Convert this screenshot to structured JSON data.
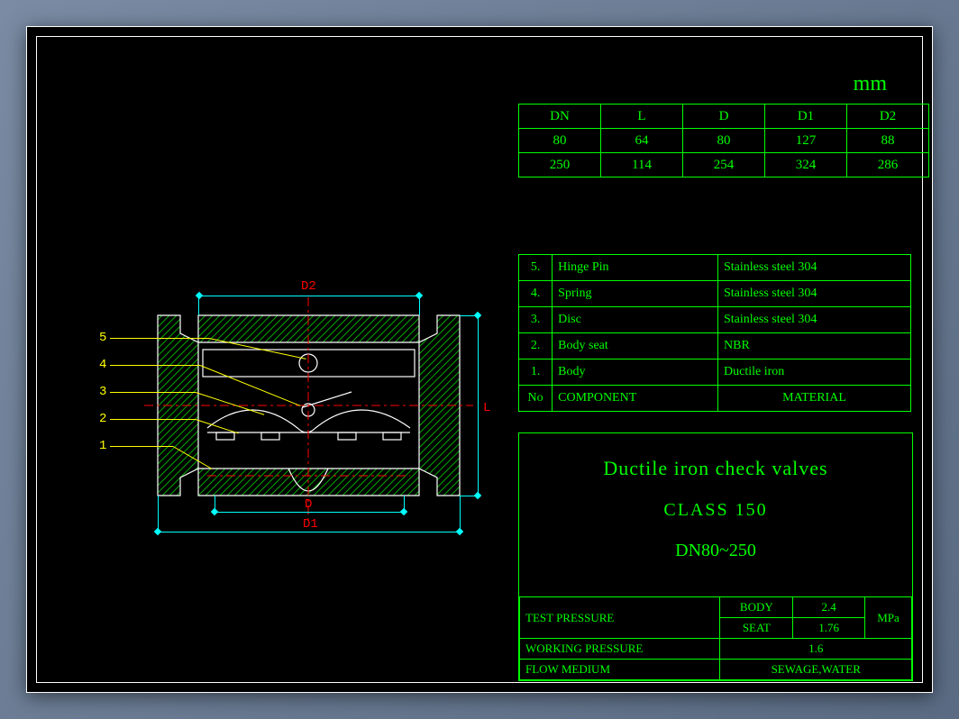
{
  "unit": "mm",
  "dim_table": {
    "headers": [
      "DN",
      "L",
      "D",
      "D1",
      "D2"
    ],
    "rows": [
      [
        "80",
        "64",
        "80",
        "127",
        "88"
      ],
      [
        "250",
        "114",
        "254",
        "324",
        "286"
      ]
    ]
  },
  "bom": {
    "header_no": "No",
    "header_comp": "COMPONENT",
    "header_mat": "MATERIAL",
    "rows": [
      {
        "no": "5.",
        "comp": "Hinge Pin",
        "mat": "Stainless steel 304"
      },
      {
        "no": "4.",
        "comp": "Spring",
        "mat": "Stainless steel 304"
      },
      {
        "no": "3.",
        "comp": "Disc",
        "mat": "Stainless steel 304"
      },
      {
        "no": "2.",
        "comp": "Body seat",
        "mat": "NBR"
      },
      {
        "no": "1.",
        "comp": "Body",
        "mat": "Ductile  iron"
      }
    ]
  },
  "title": {
    "main": "Ductile iron check valves",
    "class": "CLASS 150",
    "range": "DN80~250"
  },
  "specs": {
    "test_pressure_label": "TEST PRESSURE",
    "body_label": "BODY",
    "body_val": "2.4",
    "seat_label": "SEAT",
    "seat_val": "1.76",
    "unit": "MPa",
    "working_pressure_label": "WORKING PRESSURE",
    "working_pressure_val": "1.6",
    "flow_medium_label": "FLOW MEDIUM",
    "flow_medium_val": "SEWAGE,WATER"
  },
  "callouts": {
    "c1": "1",
    "c2": "2",
    "c3": "3",
    "c4": "4",
    "c5": "5"
  },
  "dim_labels": {
    "D": "D",
    "D1": "D1",
    "D2": "D2",
    "L": "L"
  }
}
